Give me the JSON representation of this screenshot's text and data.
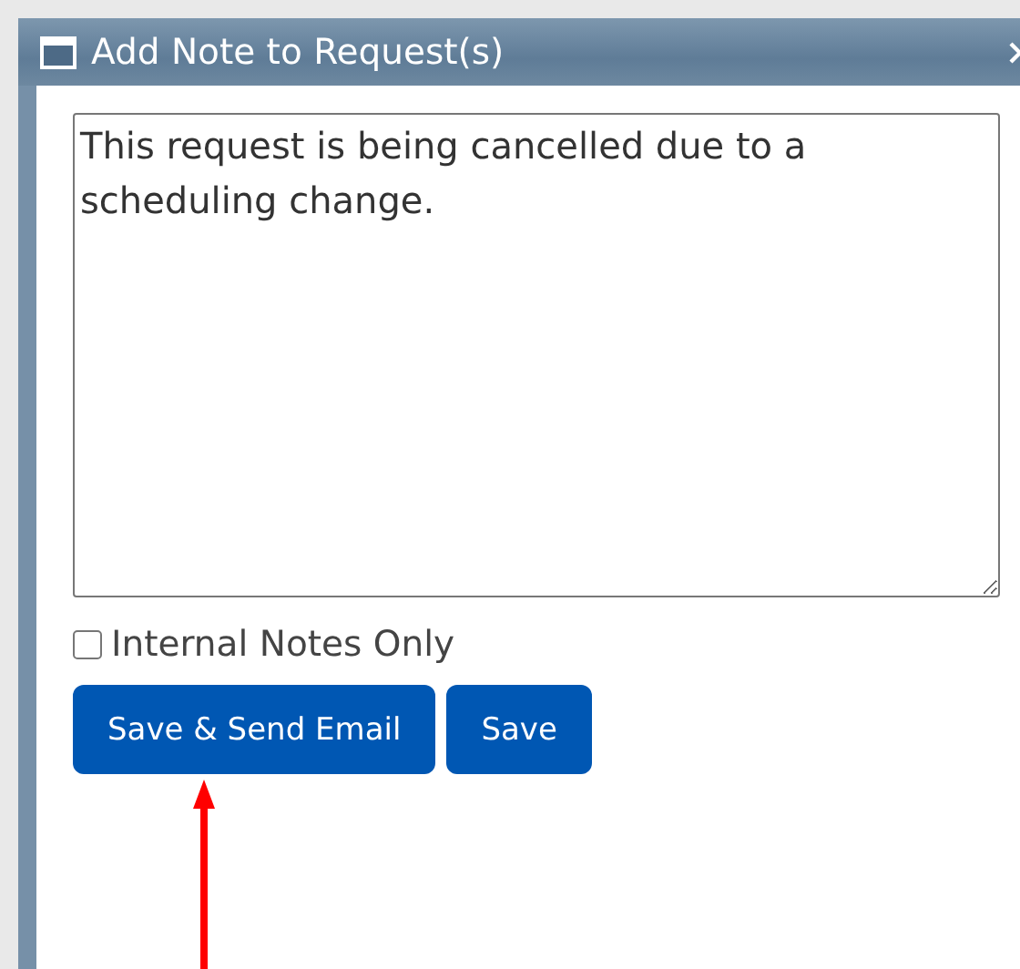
{
  "dialog": {
    "title": "Add Note to Request(s)"
  },
  "note": {
    "value": "This request is being cancelled due to a scheduling change."
  },
  "internal_only": {
    "label": "Internal Notes Only",
    "checked": false
  },
  "buttons": [
    {
      "label": "Save & Send Email"
    },
    {
      "label": "Save"
    }
  ]
}
